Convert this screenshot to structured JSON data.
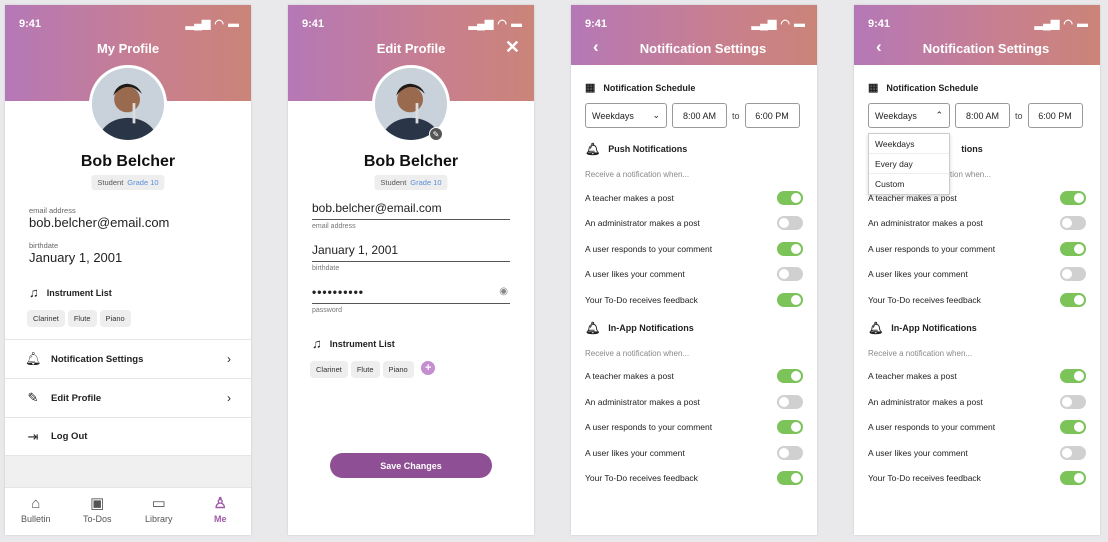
{
  "status_time": "9:41",
  "profile": {
    "title": "My Profile",
    "name": "Bob Belcher",
    "role": "Student",
    "grade": "Grade 10",
    "email_label": "email address",
    "email": "bob.belcher@email.com",
    "birthdate_label": "birthdate",
    "birthdate": "January 1, 2001",
    "instrument_title": "Instrument List",
    "instruments": [
      "Clarinet",
      "Flute",
      "Piano"
    ],
    "menu": [
      "Notification Settings",
      "Edit Profile",
      "Log Out"
    ],
    "tabs": [
      "Bulletin",
      "To-Dos",
      "Library",
      "Me"
    ]
  },
  "edit": {
    "title": "Edit Profile",
    "name": "Bob Belcher",
    "role": "Student",
    "grade": "Grade 10",
    "email": "bob.belcher@email.com",
    "email_label": "email address",
    "birthdate": "January 1, 2001",
    "birthdate_label": "birthdate",
    "password": "••••••••••",
    "password_label": "password",
    "instrument_title": "Instrument List",
    "instruments": [
      "Clarinet",
      "Flute",
      "Piano"
    ],
    "save_label": "Save Changes"
  },
  "notif": {
    "title": "Notification Settings",
    "schedule_title": "Notification Schedule",
    "days": "Weekdays",
    "start": "8:00 AM",
    "to": "to",
    "end": "6:00 PM",
    "push_title": "Push Notifications",
    "inapp_title": "In-App Notifications",
    "receive_label": "Receive a notification when...",
    "items": [
      "A teacher makes a post",
      "An administrator makes a post",
      "A user responds to your comment",
      "A user likes your comment",
      "Your To-Do receives feedback"
    ],
    "dropdown_options": [
      "Weekdays",
      "Every day",
      "Custom"
    ],
    "partial_push_title": "tions",
    "partial_receive_label": "tion when..."
  },
  "toggles_push": [
    true,
    false,
    true,
    false,
    true
  ],
  "toggles_inapp": [
    true,
    false,
    true,
    false,
    true
  ],
  "colors": {
    "accent": "#8e4f94",
    "toggle_on": "#7cc35a",
    "grade": "#5b8fd6"
  }
}
